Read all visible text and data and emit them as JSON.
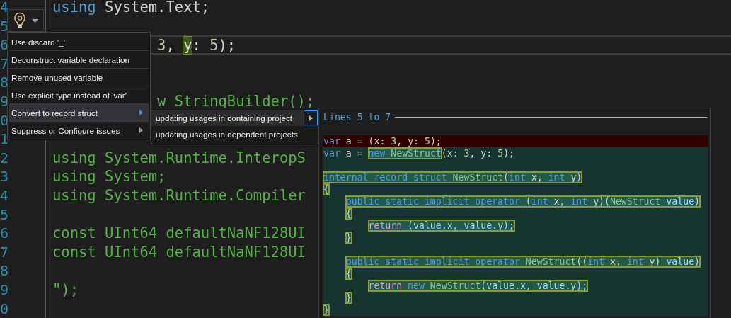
{
  "editor": {
    "lines": [
      {
        "number": "4",
        "kind": "full",
        "current": false,
        "parts": [
          {
            "t": "using",
            "kind": "keyword"
          },
          {
            "t": " System.Text;",
            "kind": "plain"
          }
        ]
      },
      {
        "number": "5",
        "kind": "full",
        "current": false
      },
      {
        "number": "6",
        "kind": "partial",
        "current": true,
        "parts": [
          {
            "t": "3",
            "kind": "number"
          },
          {
            "t": ", ",
            "kind": "plain"
          },
          {
            "t": "y",
            "kind": "match"
          },
          {
            "t": ": ",
            "kind": "plain"
          },
          {
            "t": "5",
            "kind": "number"
          },
          {
            "t": ");",
            "kind": "plain"
          }
        ]
      },
      {
        "number": "7",
        "kind": "full",
        "current": false
      },
      {
        "number": "8",
        "kind": "full",
        "current": false
      },
      {
        "number": "9",
        "kind": "partial",
        "current": false,
        "parts": [
          {
            "t": "w StringBuilder();",
            "kind": "string"
          }
        ]
      },
      {
        "number": "0",
        "kind": "full",
        "current": false
      },
      {
        "number": "1",
        "kind": "full",
        "current": false
      },
      {
        "number": "2",
        "kind": "full",
        "current": false,
        "parts": [
          {
            "t": "using System.Runtime.InteropS",
            "kind": "string"
          }
        ]
      },
      {
        "number": "3",
        "kind": "full",
        "current": false,
        "parts": [
          {
            "t": "using System;",
            "kind": "string"
          }
        ]
      },
      {
        "number": "4",
        "kind": "full",
        "current": false,
        "parts": [
          {
            "t": "using System.Runtime.Compiler",
            "kind": "string"
          }
        ]
      },
      {
        "number": "5",
        "kind": "full",
        "current": false
      },
      {
        "number": "6",
        "kind": "full",
        "current": false,
        "parts": [
          {
            "t": "const UInt64 defaultNaNF128UI",
            "kind": "string"
          }
        ]
      },
      {
        "number": "7",
        "kind": "full",
        "current": false,
        "parts": [
          {
            "t": "const UInt64 defaultNaNF128UI",
            "kind": "string"
          }
        ]
      },
      {
        "number": "8",
        "kind": "full",
        "current": false
      },
      {
        "number": "9",
        "kind": "full",
        "current": false,
        "parts": [
          {
            "t": "\");",
            "kind": "string"
          }
        ]
      },
      {
        "number": "0",
        "kind": "full",
        "current": false
      }
    ]
  },
  "quick_actions": {
    "items": [
      {
        "label": "Use discard '_'",
        "selected": false,
        "has_submenu": false
      },
      {
        "label": "Deconstruct variable declaration",
        "selected": false,
        "has_submenu": false
      },
      {
        "label": "Remove unused variable",
        "selected": false,
        "has_submenu": false
      },
      {
        "label": "Use explicit type instead of 'var'",
        "selected": false,
        "has_submenu": false
      },
      {
        "label": "Convert to record struct",
        "selected": true,
        "has_submenu": true
      },
      {
        "label": "Suppress or Configure issues",
        "selected": false,
        "has_submenu": true
      }
    ],
    "submenu": [
      {
        "label": "updating usages in containing project",
        "selected": true,
        "has_submenu": true
      },
      {
        "label": "updating usages in dependent projects",
        "selected": false,
        "has_submenu": false
      }
    ]
  },
  "preview": {
    "title": "Lines 5 to 7",
    "lines": [
      {
        "kind": "removed",
        "parts": [
          {
            "t": "var",
            "kind": "keyword"
          },
          {
            "t": " a = (x: ",
            "kind": "plain"
          },
          {
            "t": "3",
            "kind": "number"
          },
          {
            "t": ", y: ",
            "kind": "plain"
          },
          {
            "t": "5",
            "kind": "number"
          },
          {
            "t": ");",
            "kind": "plain"
          }
        ]
      },
      {
        "kind": "added",
        "parts": [
          {
            "t": "var",
            "kind": "keyword"
          },
          {
            "t": " a = ",
            "kind": "plain"
          },
          {
            "kind": "box",
            "tokens": [
              {
                "t": "new",
                "kind": "keyword"
              },
              {
                "t": " NewStruct",
                "kind": "type"
              }
            ]
          },
          {
            "t": "(x: ",
            "kind": "plain"
          },
          {
            "t": "3",
            "kind": "number"
          },
          {
            "t": ", y: ",
            "kind": "plain"
          },
          {
            "t": "5",
            "kind": "number"
          },
          {
            "t": ");",
            "kind": "plain"
          }
        ]
      },
      {
        "kind": "added"
      },
      {
        "kind": "added",
        "parts": [
          {
            "kind": "box",
            "tokens": [
              {
                "t": "internal record struct",
                "kind": "keyword"
              },
              {
                "t": " NewStruct",
                "kind": "type"
              },
              {
                "t": "(",
                "kind": "plain"
              },
              {
                "t": "int",
                "kind": "keyword"
              },
              {
                "t": " x, ",
                "kind": "plain"
              },
              {
                "t": "int",
                "kind": "keyword"
              },
              {
                "t": " y)",
                "kind": "plain"
              }
            ]
          }
        ]
      },
      {
        "kind": "added",
        "parts": [
          {
            "kind": "box",
            "tokens": [
              {
                "t": "{",
                "kind": "plain"
              }
            ]
          }
        ]
      },
      {
        "kind": "added",
        "parts": [
          {
            "kind": "indent"
          },
          {
            "kind": "box",
            "tokens": [
              {
                "t": "public static implicit operator",
                "kind": "keyword"
              },
              {
                "t": " (",
                "kind": "plain"
              },
              {
                "t": "int",
                "kind": "keyword"
              },
              {
                "t": " x, ",
                "kind": "plain"
              },
              {
                "t": "int",
                "kind": "keyword"
              },
              {
                "t": " y)(",
                "kind": "plain"
              },
              {
                "t": "NewStruct",
                "kind": "type"
              },
              {
                "t": " value",
                "kind": "id"
              },
              {
                "t": ")",
                "kind": "plain"
              }
            ]
          }
        ]
      },
      {
        "kind": "added",
        "parts": [
          {
            "kind": "indent"
          },
          {
            "kind": "box",
            "tokens": [
              {
                "t": "{",
                "kind": "plain"
              }
            ]
          }
        ]
      },
      {
        "kind": "added",
        "parts": [
          {
            "kind": "deep-indent"
          },
          {
            "kind": "box",
            "tokens": [
              {
                "t": "return",
                "kind": "control"
              },
              {
                "t": " (value.x, value.y);",
                "kind": "id"
              }
            ]
          }
        ]
      },
      {
        "kind": "added",
        "parts": [
          {
            "kind": "indent"
          },
          {
            "kind": "box",
            "tokens": [
              {
                "t": "}",
                "kind": "plain"
              }
            ]
          }
        ]
      },
      {
        "kind": "added"
      },
      {
        "kind": "added",
        "parts": [
          {
            "kind": "indent"
          },
          {
            "kind": "box",
            "tokens": [
              {
                "t": "public static implicit operator",
                "kind": "keyword"
              },
              {
                "t": " NewStruct",
                "kind": "type"
              },
              {
                "t": "((",
                "kind": "plain"
              },
              {
                "t": "int",
                "kind": "keyword"
              },
              {
                "t": " x, ",
                "kind": "plain"
              },
              {
                "t": "int",
                "kind": "keyword"
              },
              {
                "t": " y) ",
                "kind": "plain"
              },
              {
                "t": "value",
                "kind": "id"
              },
              {
                "t": ")",
                "kind": "plain"
              }
            ]
          }
        ]
      },
      {
        "kind": "added",
        "parts": [
          {
            "kind": "indent"
          },
          {
            "kind": "box",
            "tokens": [
              {
                "t": "{",
                "kind": "plain"
              }
            ]
          }
        ]
      },
      {
        "kind": "added",
        "parts": [
          {
            "kind": "deep-indent"
          },
          {
            "kind": "box",
            "tokens": [
              {
                "t": "return",
                "kind": "control"
              },
              {
                "t": " new",
                "kind": "keyword"
              },
              {
                "t": " NewStruct",
                "kind": "type"
              },
              {
                "t": "(value.x, value.y);",
                "kind": "id"
              }
            ]
          }
        ]
      },
      {
        "kind": "added",
        "parts": [
          {
            "kind": "indent"
          },
          {
            "kind": "box",
            "tokens": [
              {
                "t": "}",
                "kind": "plain"
              }
            ]
          }
        ]
      },
      {
        "kind": "added",
        "parts": [
          {
            "kind": "box",
            "tokens": [
              {
                "t": "}",
                "kind": "plain"
              }
            ]
          }
        ]
      }
    ]
  }
}
